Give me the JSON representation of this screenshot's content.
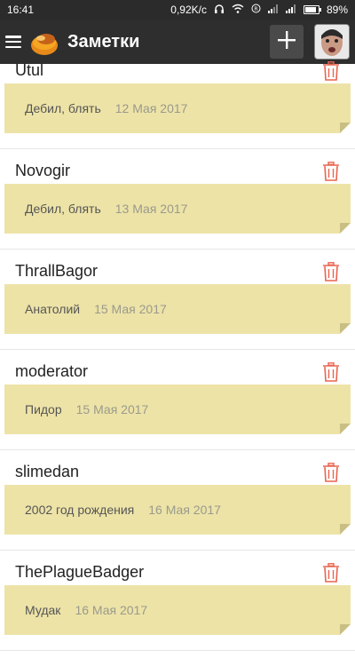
{
  "status_bar": {
    "time": "16:41",
    "net_speed": "0,92K/c",
    "battery": "89%",
    "battery_level": 0.89
  },
  "app_bar": {
    "title": "Заметки",
    "menu_icon": "hamburger-menu-icon",
    "add_icon": "plus-icon",
    "logo_icon": "app-logo-icon"
  },
  "notes": [
    {
      "title": "Utul",
      "text": "Дебил, блять",
      "date": "12 Мая 2017"
    },
    {
      "title": "Novogir",
      "text": "Дебил, блять",
      "date": "13 Мая 2017"
    },
    {
      "title": "ThrallBagor",
      "text": "Анатолий",
      "date": "15 Мая 2017"
    },
    {
      "title": "moderator",
      "text": "Пидор",
      "date": "15 Мая 2017"
    },
    {
      "title": "slimedan",
      "text": "2002 год рождения",
      "date": "16 Мая 2017"
    },
    {
      "title": "ThePlagueBadger",
      "text": "Мудак",
      "date": "16 Мая 2017"
    }
  ],
  "colors": {
    "app_bar": "#2e2e2e",
    "note_card": "#ede3a7",
    "trash": "#e8644f"
  }
}
